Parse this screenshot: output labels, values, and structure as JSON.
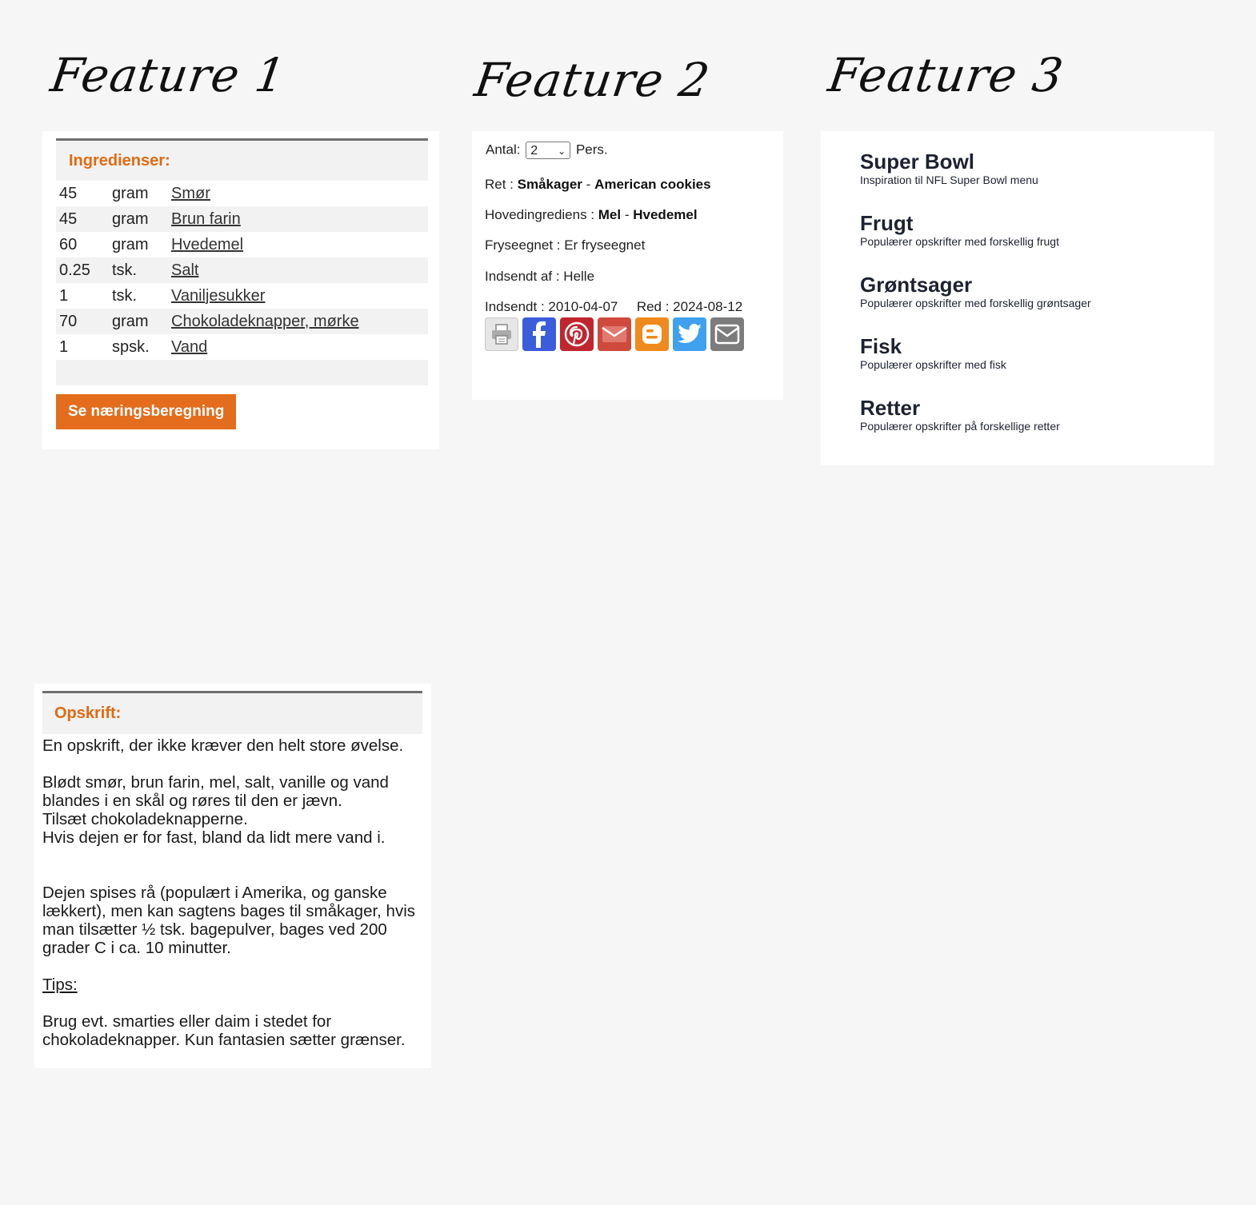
{
  "headings": {
    "f1": "Feature 1",
    "f2": "Feature 2",
    "f3": "Feature 3"
  },
  "ingredients": {
    "title": "Ingredienser:",
    "rows": [
      {
        "amount": "45",
        "unit": "gram",
        "name": "Smør"
      },
      {
        "amount": "45",
        "unit": "gram",
        "name": "Brun farin"
      },
      {
        "amount": "60",
        "unit": "gram",
        "name": "Hvedemel"
      },
      {
        "amount": "0.25",
        "unit": "tsk.",
        "name": "Salt"
      },
      {
        "amount": "1",
        "unit": "tsk.",
        "name": "Vaniljesukker"
      },
      {
        "amount": "70",
        "unit": "gram",
        "name": "Chokoladeknapper, mørke"
      },
      {
        "amount": "1",
        "unit": "spsk.",
        "name": "Vand"
      }
    ],
    "button": "Se næringsberegning"
  },
  "details": {
    "antal_label": "Antal:",
    "antal_value": "2",
    "pers": "Pers.",
    "ret_label": "Ret :",
    "ret_category": "Småkager",
    "ret_sep": "-",
    "ret_name": "American cookies",
    "hoved_label": "Hovedingrediens :",
    "hoved_a": "Mel",
    "hoved_sep": "-",
    "hoved_b": "Hvedemel",
    "frys": "Fryseegnet : Er fryseegnet",
    "indsendt_af": "Indsendt af : Helle",
    "indsendt": "Indsendt : 2010-04-07",
    "red": "Red : 2024-08-12",
    "share_icons": [
      "printer-icon",
      "facebook-icon",
      "pinterest-icon",
      "gmail-icon",
      "blogger-icon",
      "twitter-icon",
      "email-icon"
    ],
    "colors": {
      "printer": "#e6e6e6",
      "facebook": "#3b5ddb",
      "pinterest": "#c0262d",
      "gmail": "#cf4a3d",
      "blogger": "#f08a1c",
      "twitter": "#3fa0ee",
      "email": "#7c7c7c"
    }
  },
  "categories": [
    {
      "title": "Super Bowl",
      "desc": "Inspiration til NFL Super Bowl menu"
    },
    {
      "title": "Frugt",
      "desc": "Populærer opskrifter med forskellig frugt"
    },
    {
      "title": "Grøntsager",
      "desc": "Populærer opskrifter med forskellig grøntsager"
    },
    {
      "title": "Fisk",
      "desc": "Populærer opskrifter med fisk"
    },
    {
      "title": "Retter",
      "desc": "Populærer opskrifter på forskellige retter"
    }
  ],
  "recipe": {
    "title": "Opskrift:",
    "intro": "En opskrift, der ikke kræver den helt store øvelse.",
    "step1a": "Blødt smør, brun farin, mel, salt, vanille og vand",
    "step1b": "blandes i en skål og røres til den er jævn.",
    "step2": "Tilsæt chokoladeknapperne.",
    "step3": "Hvis dejen er for fast, bland da lidt mere vand i.",
    "note_a": "Dejen spises rå (populært i Amerika, og ganske",
    "note_b": "lækkert), men kan sagtens bages til småkager, hvis",
    "note_c": "man tilsætter ½ tsk. bagepulver, bages ved 200",
    "note_d": "grader C i ca. 10 minutter.",
    "tips_label": "Tips:",
    "tips_a": "Brug evt. smarties eller daim i stedet for",
    "tips_b": "chokoladeknapper. Kun fantasien sætter grænser."
  },
  "accent_color": "#e36d1d"
}
